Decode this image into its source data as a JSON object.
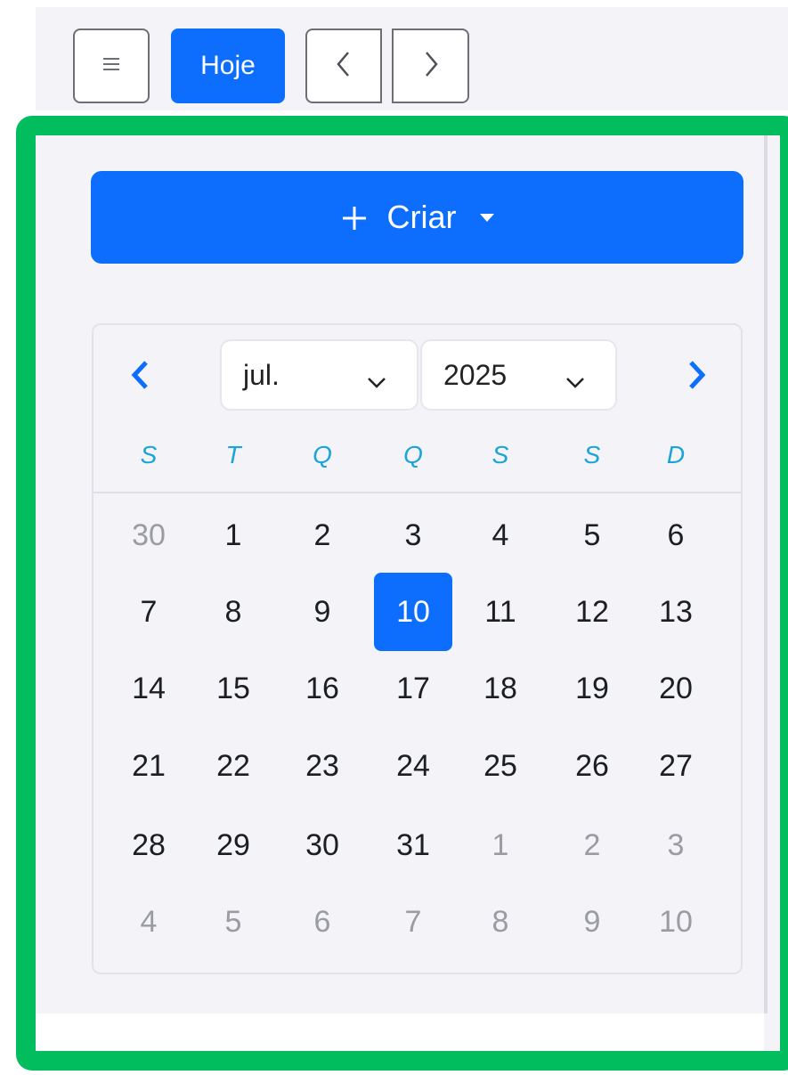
{
  "toolbar": {
    "menu_icon": "hamburger-icon",
    "today_label": "Hoje",
    "prev_icon": "chevron-left-icon",
    "next_icon": "chevron-right-icon"
  },
  "sidebar": {
    "create_label": "Criar",
    "create_icon": "plus-icon"
  },
  "mini_calendar": {
    "month": "jul.",
    "year": "2025",
    "weekdays": [
      "S",
      "T",
      "Q",
      "Q",
      "S",
      "S",
      "D"
    ],
    "selected_day": "10",
    "weeks": [
      [
        [
          "30",
          true
        ],
        [
          "1",
          false
        ],
        [
          "2",
          false
        ],
        [
          "3",
          false
        ],
        [
          "4",
          false
        ],
        [
          "5",
          false
        ],
        [
          "6",
          false
        ]
      ],
      [
        [
          "7",
          false
        ],
        [
          "8",
          false
        ],
        [
          "9",
          false
        ],
        [
          "10",
          false
        ],
        [
          "11",
          false
        ],
        [
          "12",
          false
        ],
        [
          "13",
          false
        ]
      ],
      [
        [
          "14",
          false
        ],
        [
          "15",
          false
        ],
        [
          "16",
          false
        ],
        [
          "17",
          false
        ],
        [
          "18",
          false
        ],
        [
          "19",
          false
        ],
        [
          "20",
          false
        ]
      ],
      [
        [
          "21",
          false
        ],
        [
          "22",
          false
        ],
        [
          "23",
          false
        ],
        [
          "24",
          false
        ],
        [
          "25",
          false
        ],
        [
          "26",
          false
        ],
        [
          "27",
          false
        ]
      ],
      [
        [
          "28",
          false
        ],
        [
          "29",
          false
        ],
        [
          "30",
          false
        ],
        [
          "31",
          false
        ],
        [
          "1",
          true
        ],
        [
          "2",
          true
        ],
        [
          "3",
          true
        ]
      ],
      [
        [
          "4",
          true
        ],
        [
          "5",
          true
        ],
        [
          "6",
          true
        ],
        [
          "7",
          true
        ],
        [
          "8",
          true
        ],
        [
          "9",
          true
        ],
        [
          "10",
          true
        ]
      ]
    ]
  },
  "colors": {
    "primary": "#0d6efd",
    "highlight_border": "#02bd5e",
    "weekday_text": "#1aa4d8",
    "muted_day": "#9a9ca1"
  }
}
